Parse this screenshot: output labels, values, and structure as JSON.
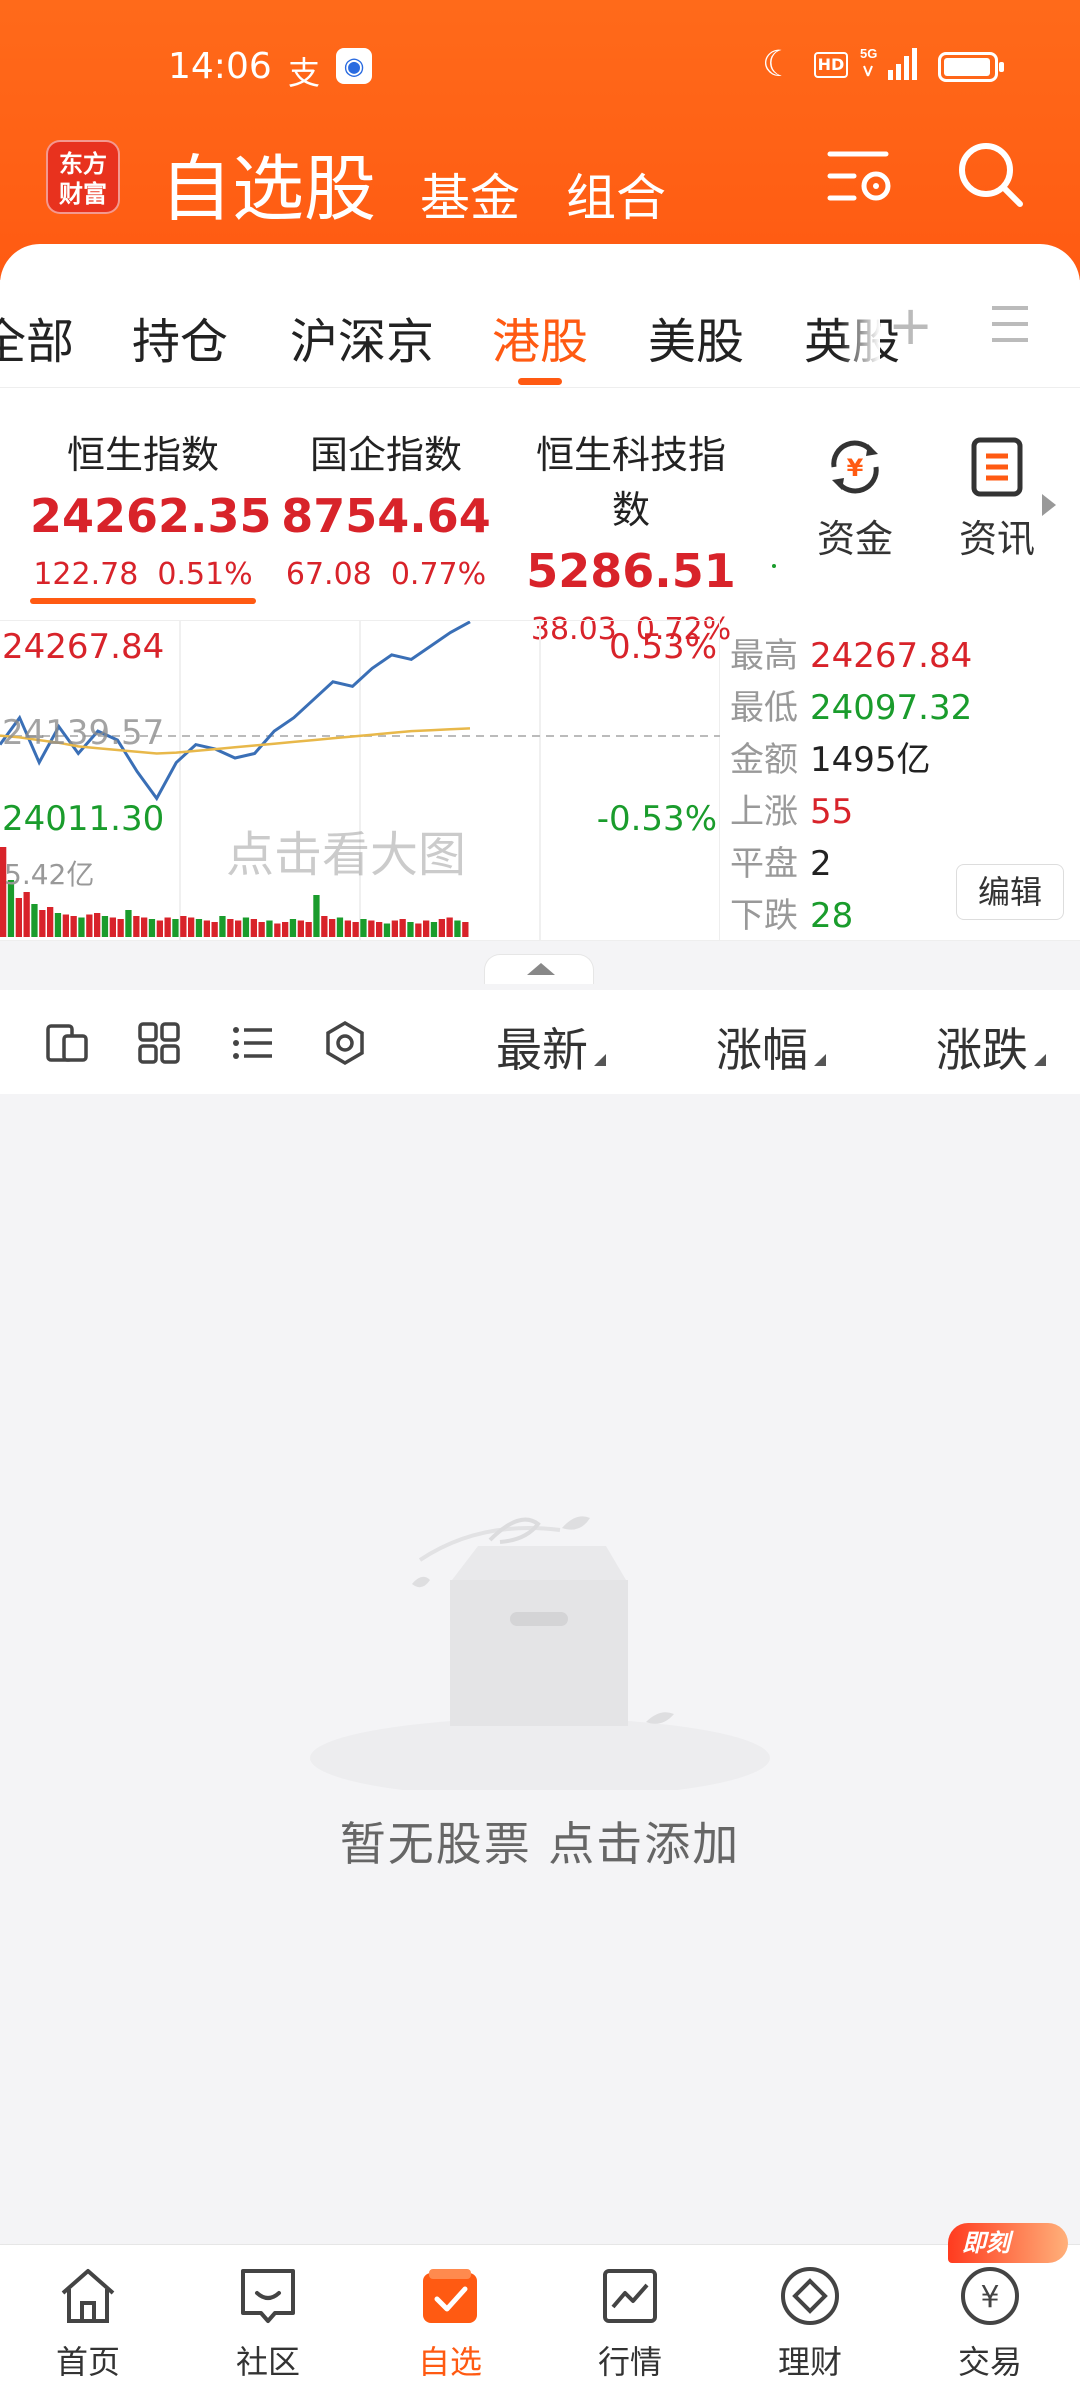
{
  "status_bar": {
    "time": "14:06",
    "hd_label": "HD",
    "network_label": "5G"
  },
  "header": {
    "logo_text": "东方财富",
    "title": "自选股",
    "sub_tabs": [
      "基金",
      "组合"
    ]
  },
  "market_tabs": [
    {
      "label": "全部"
    },
    {
      "label": "持仓"
    },
    {
      "label": "沪深京"
    },
    {
      "label": "港股",
      "active": true
    },
    {
      "label": "美股"
    },
    {
      "label": "英股"
    }
  ],
  "indices": [
    {
      "name": "恒生指数",
      "value": "24262.35",
      "change": "122.78",
      "pct": "0.51%"
    },
    {
      "name": "国企指数",
      "value": "8754.64",
      "change": "67.08",
      "pct": "0.77%"
    },
    {
      "name": "恒生科技指数",
      "value": "5286.51",
      "change": "38.03",
      "pct": "0.72%"
    }
  ],
  "side_buttons": {
    "funds": "资金",
    "news": "资讯"
  },
  "chart_data": {
    "type": "line",
    "y_high": "24267.84",
    "y_prev_close": "24139.57",
    "y_low": "24011.30",
    "pct_high": "0.53%",
    "pct_low": "-0.53%",
    "volume_label": "5.42亿",
    "watermark": "点击看大图",
    "series": [
      {
        "values": [
          24130,
          24160,
          24110,
          24150,
          24120,
          24145,
          24135,
          24100,
          24070,
          24110,
          24130,
          24125,
          24115,
          24120,
          24145,
          24160,
          24180,
          24200,
          24195,
          24215,
          24230,
          24225,
          24240,
          24255,
          24267
        ]
      },
      {
        "values": [
          24140,
          24138,
          24135,
          24132,
          24128,
          24126,
          24124,
          24122,
          24120,
          24121,
          24123,
          24125,
          24127,
          24129,
          24131,
          24133,
          24135,
          24137,
          24139,
          24141,
          24143,
          24145,
          24146,
          24147,
          24148
        ]
      }
    ],
    "volume": [
      60,
      38,
      26,
      30,
      22,
      18,
      20,
      16,
      15,
      14,
      13,
      15,
      16,
      14,
      13,
      12,
      18,
      14,
      13,
      12,
      11,
      13,
      12,
      14,
      13,
      12,
      11,
      10,
      14,
      12,
      11,
      13,
      12,
      10,
      11,
      9,
      10,
      12,
      11,
      10,
      28,
      14,
      12,
      13,
      11,
      10,
      12,
      11,
      10,
      9,
      11,
      12,
      10,
      9,
      11,
      10,
      12,
      13,
      11,
      10
    ]
  },
  "stats": {
    "high_label": "最高",
    "high": "24267.84",
    "low_label": "最低",
    "low": "24097.32",
    "amount_label": "金额",
    "amount": "1495亿",
    "up_label": "上涨",
    "up": "55",
    "flat_label": "平盘",
    "flat": "2",
    "down_label": "下跌",
    "down": "28",
    "edit": "编辑"
  },
  "toolbar": {
    "sort_latest": "最新",
    "sort_pct": "涨幅",
    "sort_change": "涨跌"
  },
  "empty_state": {
    "text": "暂无股票  点击添加"
  },
  "bottom_nav": {
    "items": [
      {
        "label": "首页",
        "icon": "home-icon"
      },
      {
        "label": "社区",
        "icon": "community-icon"
      },
      {
        "label": "自选",
        "icon": "watchlist-icon",
        "active": true
      },
      {
        "label": "行情",
        "icon": "market-icon"
      },
      {
        "label": "理财",
        "icon": "wealth-icon"
      },
      {
        "label": "交易",
        "icon": "trade-icon"
      }
    ],
    "badge": "即刻"
  },
  "colors": {
    "brand": "#ff5a12",
    "up": "#d8232a",
    "down": "#1a9c2c"
  }
}
